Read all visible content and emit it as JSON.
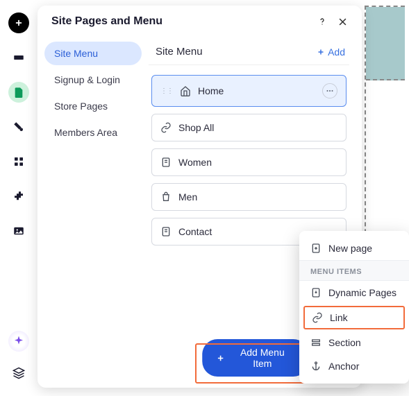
{
  "panel": {
    "title": "Site Pages and Menu"
  },
  "sidebar": {
    "items": [
      {
        "label": "Site Menu"
      },
      {
        "label": "Signup & Login"
      },
      {
        "label": "Store Pages"
      },
      {
        "label": "Members Area"
      }
    ]
  },
  "content": {
    "title": "Site Menu",
    "add_label": "Add",
    "items": [
      {
        "label": "Home",
        "icon": "home"
      },
      {
        "label": "Shop All",
        "icon": "link"
      },
      {
        "label": "Women",
        "icon": "page"
      },
      {
        "label": "Men",
        "icon": "bag"
      },
      {
        "label": "Contact",
        "icon": "page"
      }
    ],
    "add_menu_label": "Add Menu Item"
  },
  "dropdown": {
    "new_page": "New page",
    "section_header": "MENU ITEMS",
    "items": [
      {
        "label": "Dynamic Pages",
        "icon": "dynamic"
      },
      {
        "label": "Link",
        "icon": "link",
        "highlight": true
      },
      {
        "label": "Section",
        "icon": "section"
      },
      {
        "label": "Anchor",
        "icon": "anchor"
      }
    ]
  }
}
